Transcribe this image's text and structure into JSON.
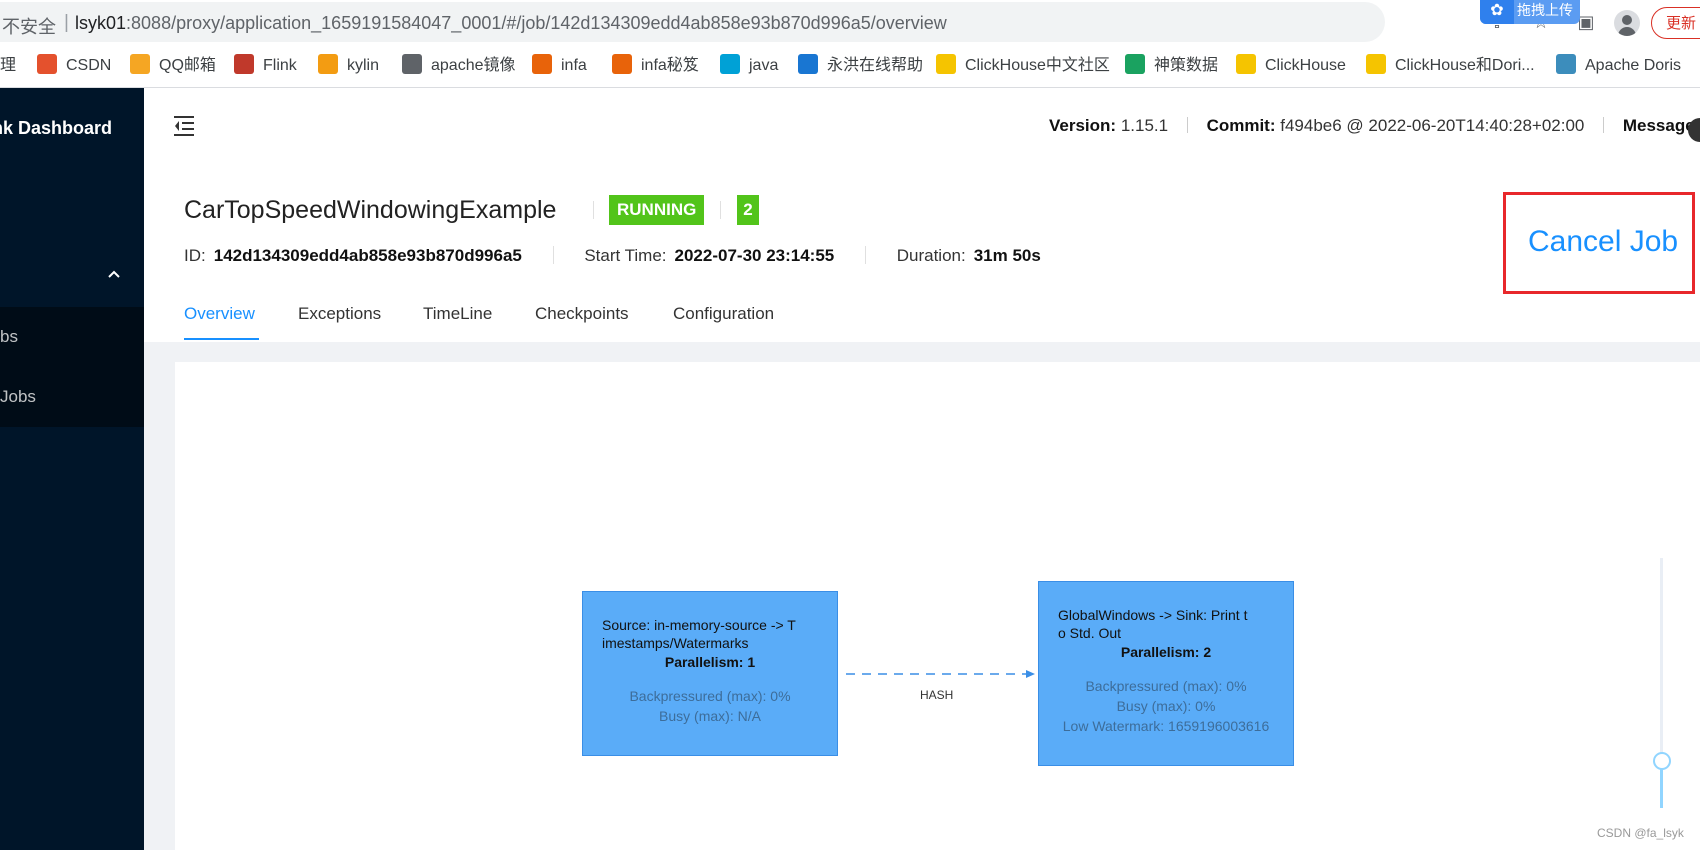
{
  "browser": {
    "insecure_label": "不安全",
    "url_host": "lsyk01",
    "url_rest": ":8088/proxy/application_1659191584047_0001/#/job/142d134309edd4ab858e93b870d996a5/overview",
    "upload_label": "拖拽上传",
    "update_label": "更新"
  },
  "bookmarks": [
    {
      "label": "理",
      "icon": "folder-icon"
    },
    {
      "label": "CSDN",
      "icon": "csdn-icon",
      "color": "#e4512d"
    },
    {
      "label": "QQ邮箱",
      "icon": "qqmail-icon",
      "color": "#f5a623"
    },
    {
      "label": "Flink",
      "icon": "flink-icon",
      "color": "#c0392b"
    },
    {
      "label": "kylin",
      "icon": "kylin-icon",
      "color": "#f39c12"
    },
    {
      "label": "apache镜像",
      "icon": "globe-icon",
      "color": "#5f6368"
    },
    {
      "label": "infa",
      "icon": "infa-icon",
      "color": "#e8630a"
    },
    {
      "label": "infa秘笈",
      "icon": "infa-icon",
      "color": "#e8630a"
    },
    {
      "label": "java",
      "icon": "bilibili-icon",
      "color": "#00a1d6"
    },
    {
      "label": "永洪在线帮助",
      "icon": "yonghong-icon",
      "color": "#1976d2"
    },
    {
      "label": "ClickHouse中文社区",
      "icon": "clickhouse-icon",
      "color": "#f5c400"
    },
    {
      "label": "神策数据",
      "icon": "sensors-icon",
      "color": "#1aa260"
    },
    {
      "label": "ClickHouse",
      "icon": "clickhouse-icon",
      "color": "#f5c400"
    },
    {
      "label": "ClickHouse和Dori...",
      "icon": "zhihu-icon",
      "color": "#f5c400"
    },
    {
      "label": "Apache Doris",
      "icon": "doris-icon",
      "color": "#3c8dbc"
    }
  ],
  "sidebar": {
    "brand": "nk Dashboard",
    "items": [
      {
        "label": "bs"
      },
      {
        "label": " Jobs"
      }
    ]
  },
  "topbar": {
    "version_label": "Version:",
    "version": "1.15.1",
    "commit_label": "Commit:",
    "commit": "f494be6 @ 2022-06-20T14:40:28+02:00",
    "message_label": "Message:"
  },
  "job": {
    "name": "CarTopSpeedWindowingExample",
    "state": "RUNNING",
    "count": "2",
    "id_label": "ID:",
    "id": "142d134309edd4ab858e93b870d996a5",
    "start_label": "Start Time:",
    "start": "2022-07-30 23:14:55",
    "duration_label": "Duration:",
    "duration": "31m 50s",
    "cancel_label": "Cancel Job"
  },
  "tabs": [
    {
      "label": "Overview",
      "active": true
    },
    {
      "label": "Exceptions"
    },
    {
      "label": "TimeLine"
    },
    {
      "label": "Checkpoints"
    },
    {
      "label": "Configuration"
    }
  ],
  "graph": {
    "nodes": [
      {
        "title_line1": "Source: in-memory-source -> T",
        "title_line2": "imestamps/Watermarks",
        "parallelism": "Parallelism: 1",
        "backpressured": "Backpressured (max): 0%",
        "busy": "Busy (max): N/A"
      },
      {
        "title_line1": "GlobalWindows -> Sink: Print t",
        "title_line2": "o Std. Out",
        "parallelism": "Parallelism: 2",
        "backpressured": "Backpressured (max): 0%",
        "busy": "Busy (max): 0%",
        "watermark": "Low Watermark: 1659196003616"
      }
    ],
    "edge_label": "HASH",
    "zoom_level": 0.18
  },
  "footer_credit": "CSDN @fa_lsyk",
  "colors": {
    "sidebar": "#001529",
    "accent": "#1890ff",
    "running": "#52c41a",
    "node_fill": "#5aacf8",
    "highlight": "#e8282b"
  }
}
